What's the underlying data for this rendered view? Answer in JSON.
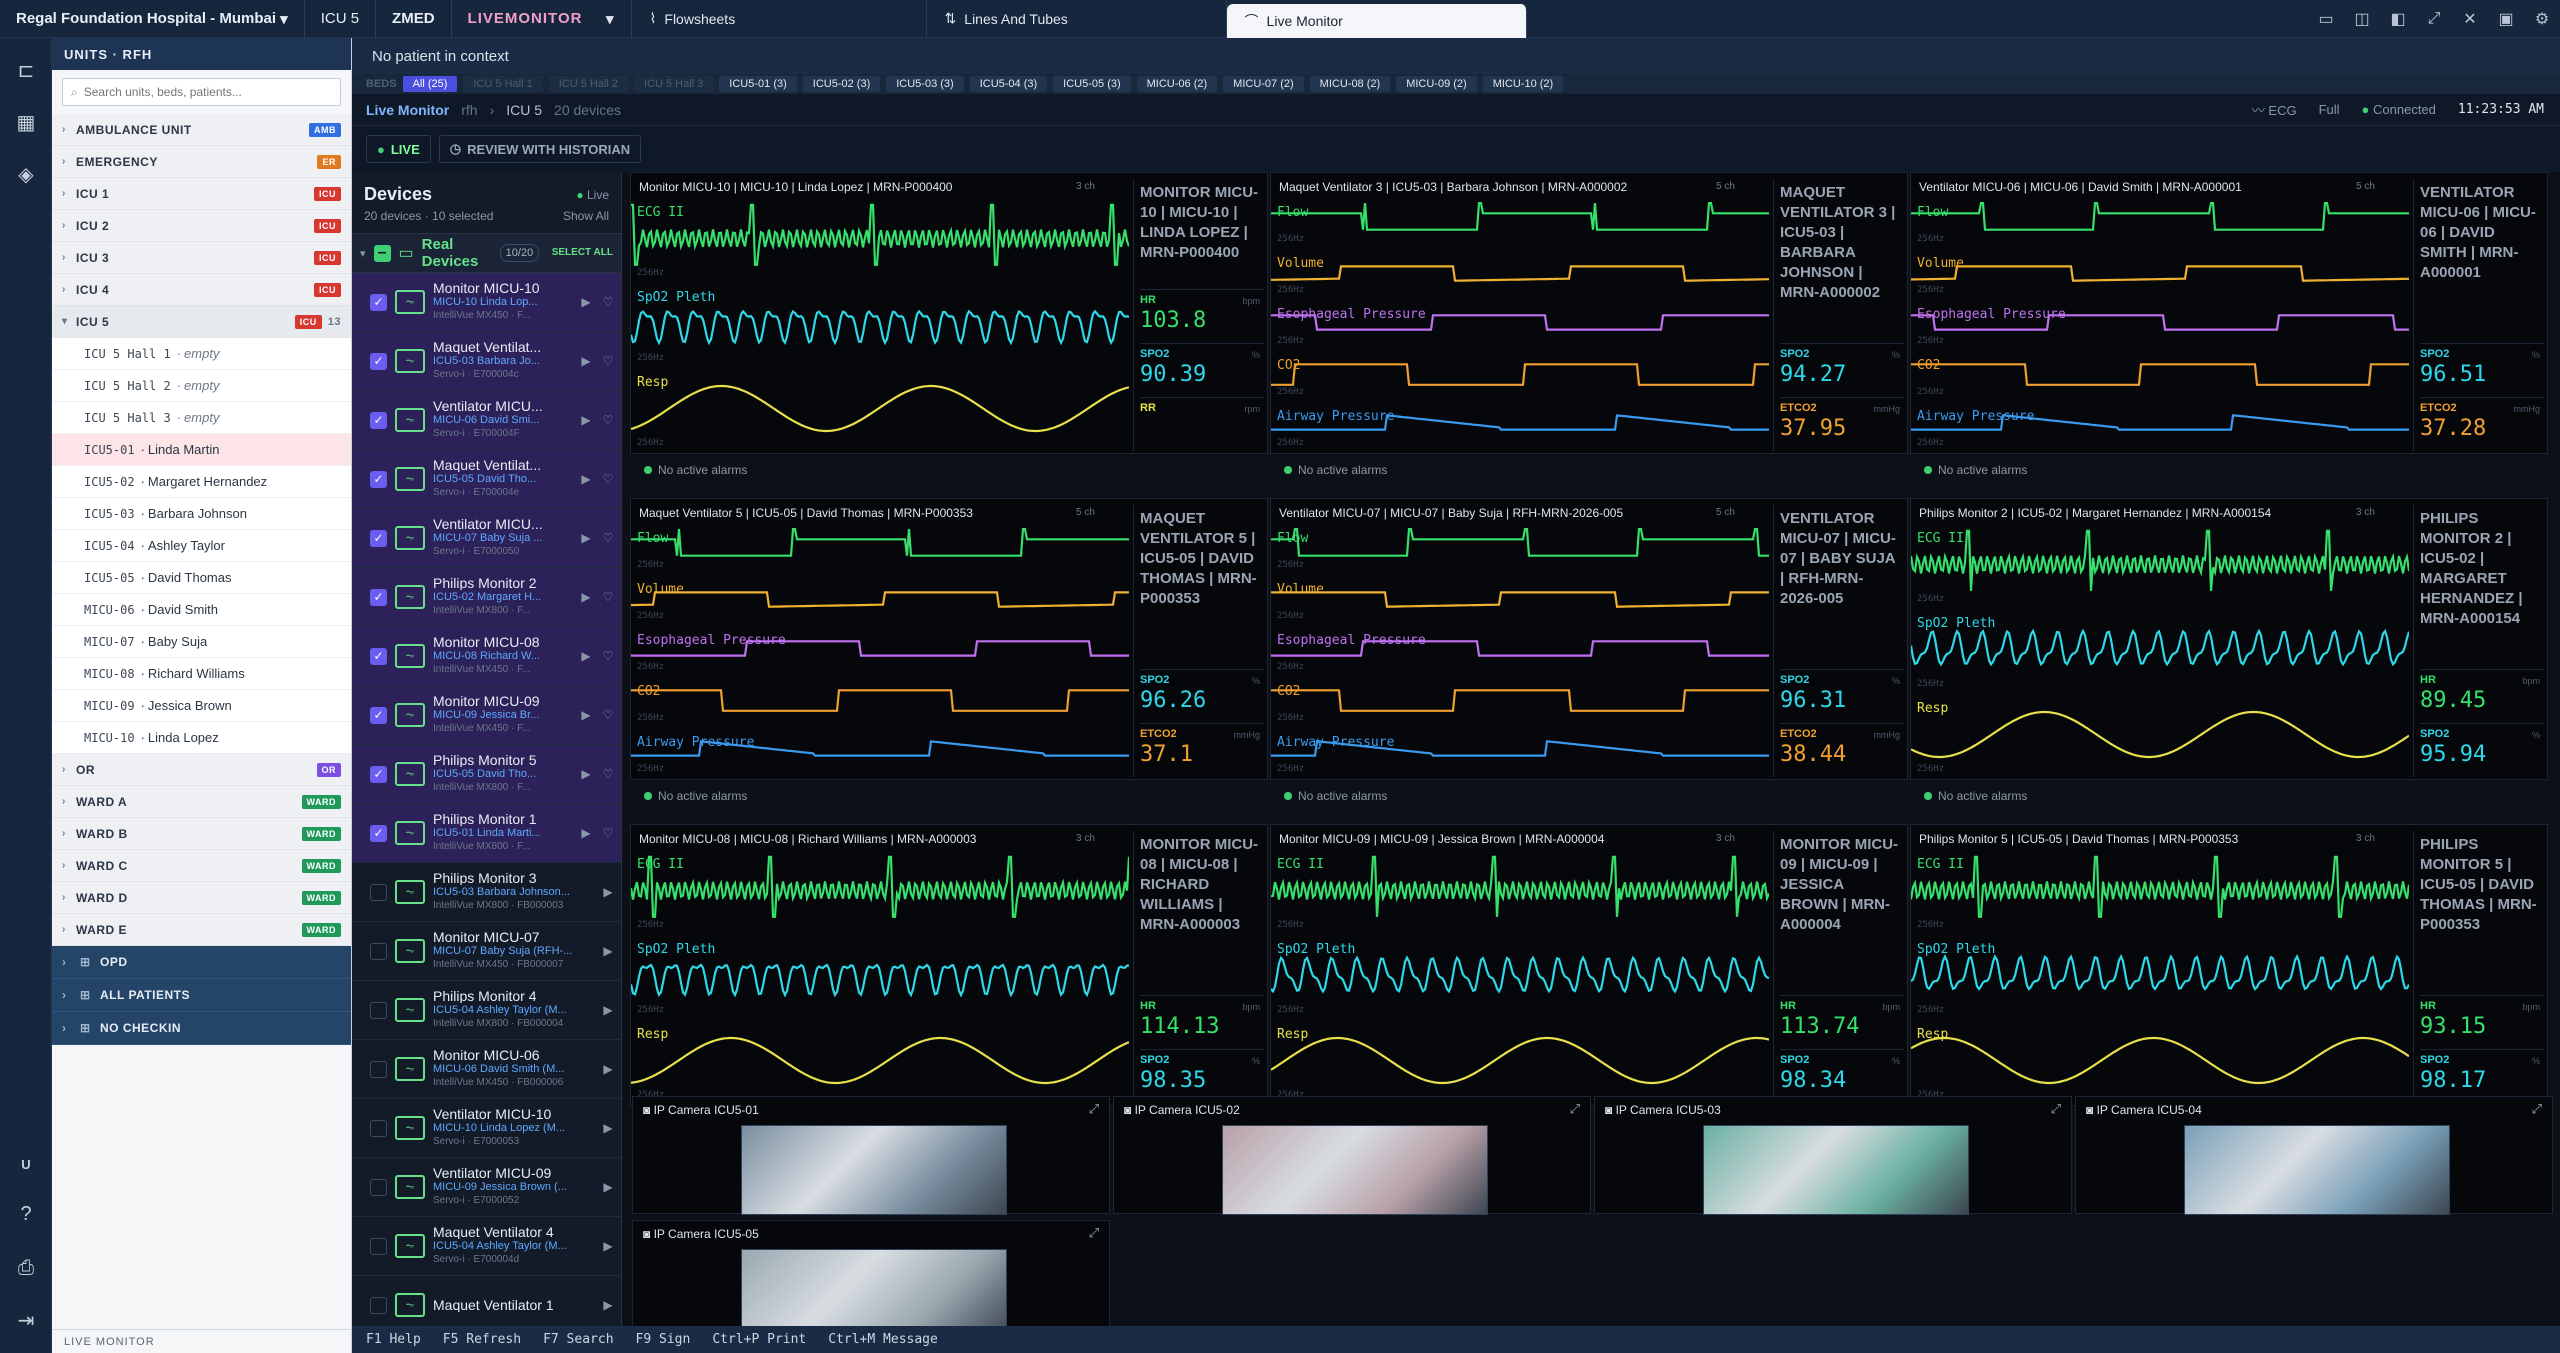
{
  "topbar": {
    "hospital": "Regal Foundation Hospital - Mumbai",
    "unit": "ICU 5",
    "app": "ZMED",
    "module": "LIVEMONITOR",
    "tabs": [
      {
        "label": "Flowsheets"
      },
      {
        "label": "Lines And Tubes"
      },
      {
        "label": "Live Monitor"
      }
    ]
  },
  "units": {
    "header": "UNITS · RFH",
    "search_placeholder": "Search units, beds, patients...",
    "list_top": [
      {
        "name": "AMBULANCE UNIT",
        "badge": "AMB",
        "color": "#2f6fe0"
      },
      {
        "name": "EMERGENCY",
        "badge": "ER",
        "color": "#e07a1f"
      },
      {
        "name": "ICU 1",
        "badge": "ICU",
        "color": "#d8382f"
      },
      {
        "name": "ICU 2",
        "badge": "ICU",
        "color": "#d8382f"
      },
      {
        "name": "ICU 3",
        "badge": "ICU",
        "color": "#d8382f"
      },
      {
        "name": "ICU 4",
        "badge": "ICU",
        "color": "#d8382f"
      }
    ],
    "icu5": {
      "name": "ICU 5",
      "badge": "ICU",
      "count": "13",
      "color": "#d8382f"
    },
    "beds": [
      {
        "code": "ICU 5 Hall 1",
        "patient": "empty",
        "empty": true
      },
      {
        "code": "ICU 5 Hall 2",
        "patient": "empty",
        "empty": true
      },
      {
        "code": "ICU 5 Hall 3",
        "patient": "empty",
        "empty": true
      },
      {
        "code": "ICU5-01",
        "patient": "Linda Martin",
        "selected": true
      },
      {
        "code": "ICU5-02",
        "patient": "Margaret Hernandez"
      },
      {
        "code": "ICU5-03",
        "patient": "Barbara Johnson"
      },
      {
        "code": "ICU5-04",
        "patient": "Ashley Taylor"
      },
      {
        "code": "ICU5-05",
        "patient": "David Thomas"
      },
      {
        "code": "MICU-06",
        "patient": "David Smith"
      },
      {
        "code": "MICU-07",
        "patient": "Baby Suja"
      },
      {
        "code": "MICU-08",
        "patient": "Richard Williams"
      },
      {
        "code": "MICU-09",
        "patient": "Jessica Brown"
      },
      {
        "code": "MICU-10",
        "patient": "Linda Lopez"
      }
    ],
    "list_bottom": [
      {
        "name": "OR",
        "badge": "OR",
        "color": "#7b4fe0"
      },
      {
        "name": "WARD A",
        "badge": "WARD",
        "color": "#1f9a5a"
      },
      {
        "name": "WARD B",
        "badge": "WARD",
        "color": "#1f9a5a"
      },
      {
        "name": "WARD C",
        "badge": "WARD",
        "color": "#1f9a5a"
      },
      {
        "name": "WARD D",
        "badge": "WARD",
        "color": "#1f9a5a"
      },
      {
        "name": "WARD E",
        "badge": "WARD",
        "color": "#1f9a5a"
      }
    ],
    "groups": [
      "OPD",
      "ALL PATIENTS",
      "NO CHECKIN"
    ],
    "footer": "LIVE MONITOR"
  },
  "context": "No patient in context",
  "bedfilter": {
    "label": "BEDS",
    "chips": [
      {
        "t": "All (25)",
        "active": true
      },
      {
        "t": "ICU 5 Hall 1",
        "dim": true
      },
      {
        "t": "ICU 5 Hall 2",
        "dim": true
      },
      {
        "t": "ICU 5 Hall 3",
        "dim": true
      },
      {
        "t": "ICU5-01 (3)"
      },
      {
        "t": "ICU5-02 (3)"
      },
      {
        "t": "ICU5-03 (3)"
      },
      {
        "t": "ICU5-04 (3)"
      },
      {
        "t": "ICU5-05 (3)"
      },
      {
        "t": "MICU-06 (2)"
      },
      {
        "t": "MICU-07 (2)"
      },
      {
        "t": "MICU-08 (2)"
      },
      {
        "t": "MICU-09 (2)"
      },
      {
        "t": "MICU-10 (2)"
      }
    ]
  },
  "livehead": {
    "title": "Live Monitor",
    "crumb1": "rfh",
    "crumb2": "ICU 5",
    "crumb3": "20 devices",
    "ecg": "ECG",
    "full": "Full",
    "connected": "Connected",
    "time": "11:23:53 AM",
    "live_btn": "LIVE",
    "review_btn": "REVIEW WITH HISTORIAN"
  },
  "devices": {
    "title": "Devices",
    "live": "Live",
    "summary": "20 devices · 10 selected",
    "show_all": "Show All",
    "group": "Real Devices",
    "group_count": "10/20",
    "select_all": "SELECT ALL",
    "items": [
      {
        "name": "Monitor MICU-10",
        "pt": "MICU-10 Linda Lop...",
        "model": "IntelliVue MX450 · F...",
        "checked": true
      },
      {
        "name": "Maquet Ventilat...",
        "pt": "ICU5-03 Barbara Jo...",
        "model": "Servo-i · E700004c",
        "checked": true
      },
      {
        "name": "Ventilator MICU...",
        "pt": "MICU-06 David Smi...",
        "model": "Servo-i · E700004F",
        "checked": true
      },
      {
        "name": "Maquet Ventilat...",
        "pt": "ICU5-05 David Tho...",
        "model": "Servo-i · E700004e",
        "checked": true
      },
      {
        "name": "Ventilator MICU...",
        "pt": "MICU-07 Baby Suja ...",
        "model": "Servo-i · E7000050",
        "checked": true
      },
      {
        "name": "Philips Monitor 2",
        "pt": "ICU5-02 Margaret H...",
        "model": "IntelliVue MX800 · F...",
        "checked": true
      },
      {
        "name": "Monitor MICU-08",
        "pt": "MICU-08 Richard W...",
        "model": "IntelliVue MX450 · F...",
        "checked": true
      },
      {
        "name": "Monitor MICU-09",
        "pt": "MICU-09 Jessica Br...",
        "model": "IntelliVue MX450 · F...",
        "checked": true
      },
      {
        "name": "Philips Monitor 5",
        "pt": "ICU5-05 David Tho...",
        "model": "IntelliVue MX800 · F...",
        "checked": true
      },
      {
        "name": "Philips Monitor 1",
        "pt": "ICU5-01 Linda Marti...",
        "model": "IntelliVue MX800 · F...",
        "checked": true
      },
      {
        "name": "Philips Monitor 3",
        "pt": "ICU5-03 Barbara Johnson...",
        "model": "IntelliVue MX800 · FB000003",
        "checked": false
      },
      {
        "name": "Monitor MICU-07",
        "pt": "MICU-07 Baby Suja (RFH-...",
        "model": "IntelliVue MX450 · FB000007",
        "checked": false
      },
      {
        "name": "Philips Monitor 4",
        "pt": "ICU5-04 Ashley Taylor (M...",
        "model": "IntelliVue MX800 · FB000004",
        "checked": false
      },
      {
        "name": "Monitor MICU-06",
        "pt": "MICU-06 David Smith (M...",
        "model": "IntelliVue MX450 · FB000006",
        "checked": false
      },
      {
        "name": "Ventilator MICU-10",
        "pt": "MICU-10 Linda Lopez (M...",
        "model": "Servo-i · E7000053",
        "checked": false
      },
      {
        "name": "Ventilator MICU-09",
        "pt": "MICU-09 Jessica Brown (...",
        "model": "Servo-i · E7000052",
        "checked": false
      },
      {
        "name": "Maquet Ventilator 4",
        "pt": "ICU5-04 Ashley Taylor (M...",
        "model": "Servo-i · E700004d",
        "checked": false
      },
      {
        "name": "Maquet Ventilator 1",
        "pt": "",
        "model": "",
        "checked": false
      }
    ]
  },
  "monitors": [
    {
      "title": "Monitor MICU-10 | MICU-10 | Linda Lopez | MRN-P000400",
      "ch": "3 ch",
      "dev": "MONITOR MICU-10 | MICU-10 | LINDA LOPEZ | MRN-P000400",
      "kind": "ecg",
      "vitals": [
        {
          "l": "HR",
          "u": "bpm",
          "v": "103.8",
          "c": "#37e06b"
        },
        {
          "l": "SPO2",
          "u": "%",
          "v": "90.39",
          "c": "#2fd8e8"
        },
        {
          "l": "RR",
          "u": "rpm",
          "v": "",
          "c": "#e8e04a"
        }
      ]
    },
    {
      "title": "Maquet Ventilator 3 | ICU5-03 | Barbara Johnson | MRN-A000002",
      "ch": "5 ch",
      "dev": "MAQUET VENTILATOR 3 | ICU5-03 | BARBARA JOHNSON | MRN-A000002",
      "kind": "vent",
      "vitals": [
        {
          "l": "SPO2",
          "u": "%",
          "v": "94.27",
          "c": "#2fd8e8"
        },
        {
          "l": "ETCO2",
          "u": "mmHg",
          "v": "37.95",
          "c": "#f0a030"
        }
      ]
    },
    {
      "title": "Ventilator MICU-06 | MICU-06 | David Smith | MRN-A000001",
      "ch": "5 ch",
      "dev": "VENTILATOR MICU-06 | MICU-06 | DAVID SMITH | MRN-A000001",
      "kind": "vent",
      "vitals": [
        {
          "l": "SPO2",
          "u": "%",
          "v": "96.51",
          "c": "#2fd8e8"
        },
        {
          "l": "ETCO2",
          "u": "mmHg",
          "v": "37.28",
          "c": "#f0a030"
        }
      ]
    },
    {
      "title": "Maquet Ventilator 5 | ICU5-05 | David Thomas | MRN-P000353",
      "ch": "5 ch",
      "dev": "MAQUET VENTILATOR 5 | ICU5-05 | DAVID THOMAS | MRN-P000353",
      "kind": "vent",
      "vitals": [
        {
          "l": "SPO2",
          "u": "%",
          "v": "96.26",
          "c": "#2fd8e8"
        },
        {
          "l": "ETCO2",
          "u": "mmHg",
          "v": "37.1",
          "c": "#f0a030"
        }
      ]
    },
    {
      "title": "Ventilator MICU-07 | MICU-07 | Baby Suja | RFH-MRN-2026-005",
      "ch": "5 ch",
      "dev": "VENTILATOR MICU-07 | MICU-07 | BABY SUJA | RFH-MRN-2026-005",
      "kind": "vent",
      "vitals": [
        {
          "l": "SPO2",
          "u": "%",
          "v": "96.31",
          "c": "#2fd8e8"
        },
        {
          "l": "ETCO2",
          "u": "mmHg",
          "v": "38.44",
          "c": "#f0a030"
        }
      ]
    },
    {
      "title": "Philips Monitor 2 | ICU5-02 | Margaret Hernandez | MRN-A000154",
      "ch": "3 ch",
      "dev": "PHILIPS MONITOR 2 | ICU5-02 | MARGARET HERNANDEZ | MRN-A000154",
      "kind": "ecg",
      "vitals": [
        {
          "l": "HR",
          "u": "bpm",
          "v": "89.45",
          "c": "#37e06b"
        },
        {
          "l": "SPO2",
          "u": "%",
          "v": "95.94",
          "c": "#2fd8e8"
        }
      ]
    },
    {
      "title": "Monitor MICU-08 | MICU-08 | Richard Williams | MRN-A000003",
      "ch": "3 ch",
      "dev": "MONITOR MICU-08 | MICU-08 | RICHARD WILLIAMS | MRN-A000003",
      "kind": "ecg",
      "vitals": [
        {
          "l": "HR",
          "u": "bpm",
          "v": "114.13",
          "c": "#37e06b"
        },
        {
          "l": "SPO2",
          "u": "%",
          "v": "98.35",
          "c": "#2fd8e8"
        }
      ]
    },
    {
      "title": "Monitor MICU-09 | MICU-09 | Jessica Brown | MRN-A000004",
      "ch": "3 ch",
      "dev": "MONITOR MICU-09 | MICU-09 | JESSICA BROWN | MRN-A000004",
      "kind": "ecg",
      "vitals": [
        {
          "l": "HR",
          "u": "bpm",
          "v": "113.74",
          "c": "#37e06b"
        },
        {
          "l": "SPO2",
          "u": "%",
          "v": "98.34",
          "c": "#2fd8e8"
        }
      ]
    },
    {
      "title": "Philips Monitor 5 | ICU5-05 | David Thomas | MRN-P000353",
      "ch": "3 ch",
      "dev": "PHILIPS MONITOR 5 | ICU5-05 | DAVID THOMAS | MRN-P000353",
      "kind": "ecg",
      "vitals": [
        {
          "l": "HR",
          "u": "bpm",
          "v": "93.15",
          "c": "#37e06b"
        },
        {
          "l": "SPO2",
          "u": "%",
          "v": "98.17",
          "c": "#2fd8e8"
        }
      ]
    }
  ],
  "waves": {
    "ecg": [
      {
        "l": "ECG II",
        "c": "#37e06b"
      },
      {
        "l": "SpO2 Pleth",
        "c": "#2fd8e8"
      },
      {
        "l": "Resp",
        "c": "#e8e04a"
      }
    ],
    "vent": [
      {
        "l": "Flow",
        "c": "#37e06b"
      },
      {
        "l": "Volume",
        "c": "#f0b030"
      },
      {
        "l": "Esophageal Pressure",
        "c": "#c070f0"
      },
      {
        "l": "CO2",
        "c": "#f0a030"
      },
      {
        "l": "Airway Pressure",
        "c": "#3a9af0"
      }
    ],
    "scale": "256Hz"
  },
  "alarm_text": "No active alarms",
  "cameras": [
    {
      "label": "IP Camera ICU5-01",
      "tone": "#7a8ea0"
    },
    {
      "label": "IP Camera ICU5-02",
      "tone": "#b8a0a8"
    },
    {
      "label": "IP Camera ICU5-03",
      "tone": "#6ab0a0"
    },
    {
      "label": "IP Camera ICU5-04",
      "tone": "#7aa0b8"
    },
    {
      "label": "IP Camera ICU5-05",
      "tone": "#9aa8b0"
    }
  ],
  "status": [
    "F1 Help",
    "F5 Refresh",
    "F7 Search",
    "F9 Sign",
    "Ctrl+P Print",
    "Ctrl+M Message"
  ],
  "rail_bottom": "U"
}
